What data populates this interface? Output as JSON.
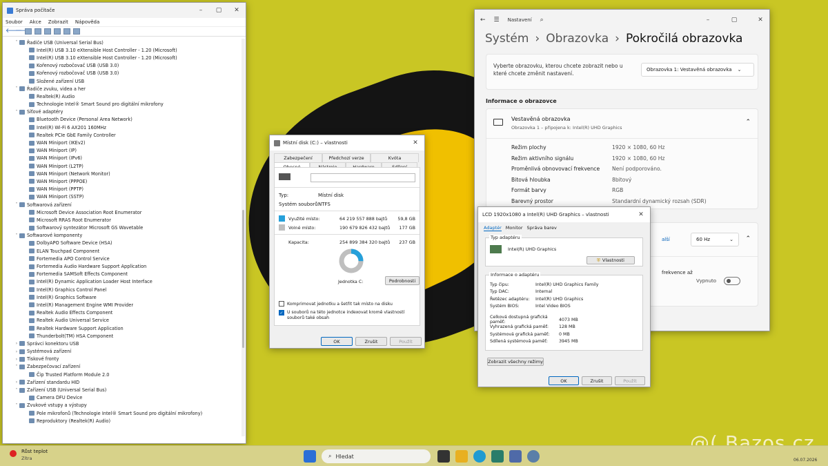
{
  "devmgr": {
    "title": "Správa počítače",
    "menu": [
      "Soubor",
      "Akce",
      "Zobrazit",
      "Nápověda"
    ],
    "tree": [
      {
        "l": 1,
        "a": "˅",
        "t": "Řadiče USB (Universal Serial Bus)"
      },
      {
        "l": 2,
        "a": "",
        "t": "Intel(R) USB 3.10 eXtensible Host Controller - 1.20 (Microsoft)"
      },
      {
        "l": 2,
        "a": "",
        "t": "Intel(R) USB 3.10 eXtensible Host Controller - 1.20 (Microsoft)"
      },
      {
        "l": 2,
        "a": "",
        "t": "Kořenový rozbočovač USB (USB 3.0)"
      },
      {
        "l": 2,
        "a": "",
        "t": "Kořenový rozbočovač USB (USB 3.0)"
      },
      {
        "l": 2,
        "a": "",
        "t": "Složené zařízení USB"
      },
      {
        "l": 1,
        "a": "˅",
        "t": "Řadiče zvuku, videa a her"
      },
      {
        "l": 2,
        "a": "",
        "t": "Realtek(R) Audio"
      },
      {
        "l": 2,
        "a": "",
        "t": "Technologie Intel® Smart Sound pro digitální mikrofony"
      },
      {
        "l": 1,
        "a": "˅",
        "t": "Síťové adaptéry"
      },
      {
        "l": 2,
        "a": "",
        "t": "Bluetooth Device (Personal Area Network)"
      },
      {
        "l": 2,
        "a": "",
        "t": "Intel(R) Wi-Fi 6 AX201 160MHz"
      },
      {
        "l": 2,
        "a": "",
        "t": "Realtek PCIe GbE Family Controller"
      },
      {
        "l": 2,
        "a": "",
        "t": "WAN Miniport (IKEv2)"
      },
      {
        "l": 2,
        "a": "",
        "t": "WAN Miniport (IP)"
      },
      {
        "l": 2,
        "a": "",
        "t": "WAN Miniport (IPv6)"
      },
      {
        "l": 2,
        "a": "",
        "t": "WAN Miniport (L2TP)"
      },
      {
        "l": 2,
        "a": "",
        "t": "WAN Miniport (Network Monitor)"
      },
      {
        "l": 2,
        "a": "",
        "t": "WAN Miniport (PPPOE)"
      },
      {
        "l": 2,
        "a": "",
        "t": "WAN Miniport (PPTP)"
      },
      {
        "l": 2,
        "a": "",
        "t": "WAN Miniport (SSTP)"
      },
      {
        "l": 1,
        "a": "˅",
        "t": "Softwarová zařízení"
      },
      {
        "l": 2,
        "a": "",
        "t": "Microsoft Device Association Root Enumerator"
      },
      {
        "l": 2,
        "a": "",
        "t": "Microsoft RRAS Root Enumerator"
      },
      {
        "l": 2,
        "a": "",
        "t": "Softwarový syntezátor Microsoft GS Wavetable"
      },
      {
        "l": 1,
        "a": "˅",
        "t": "Softwarové komponenty"
      },
      {
        "l": 2,
        "a": "",
        "t": "DolbyAPO Software Device (HSA)"
      },
      {
        "l": 2,
        "a": "",
        "t": "ELAN Touchpad Component"
      },
      {
        "l": 2,
        "a": "",
        "t": "Fortemedia APO Control Service"
      },
      {
        "l": 2,
        "a": "",
        "t": "Fortemedia Audio Hardware Support Application"
      },
      {
        "l": 2,
        "a": "",
        "t": "Fortemedia SAMSoft Effects Component"
      },
      {
        "l": 2,
        "a": "",
        "t": "Intel(R) Dynamic Application Loader Host Interface"
      },
      {
        "l": 2,
        "a": "",
        "t": "Intel(R) Graphics Control Panel"
      },
      {
        "l": 2,
        "a": "",
        "t": "Intel(R) Graphics Software"
      },
      {
        "l": 2,
        "a": "",
        "t": "Intel(R) Management Engine WMI Provider"
      },
      {
        "l": 2,
        "a": "",
        "t": "Realtek Audio Effects Component"
      },
      {
        "l": 2,
        "a": "",
        "t": "Realtek Audio Universal Service"
      },
      {
        "l": 2,
        "a": "",
        "t": "Realtek Hardware Support Application"
      },
      {
        "l": 2,
        "a": "",
        "t": "Thunderbolt(TM) HSA Component"
      },
      {
        "l": 1,
        "a": "›",
        "t": "Správci konektoru USB"
      },
      {
        "l": 1,
        "a": "›",
        "t": "Systémová zařízení"
      },
      {
        "l": 1,
        "a": "›",
        "t": "Tiskové fronty"
      },
      {
        "l": 1,
        "a": "˅",
        "t": "Zabezpečovací zařízení"
      },
      {
        "l": 2,
        "a": "",
        "t": "Čip Trusted Platform Module 2.0"
      },
      {
        "l": 1,
        "a": "›",
        "t": "Zařízení standardu HID"
      },
      {
        "l": 1,
        "a": "˅",
        "t": "Zařízení USB (Universal Serial Bus)"
      },
      {
        "l": 2,
        "a": "",
        "t": "Camera DFU Device"
      },
      {
        "l": 1,
        "a": "˅",
        "t": "Zvukové vstupy a výstupy"
      },
      {
        "l": 2,
        "a": "",
        "t": "Pole mikrofonů (Technologie Intel® Smart Sound pro digitální mikrofony)"
      },
      {
        "l": 2,
        "a": "",
        "t": "Reproduktory (Realtek(R) Audio)"
      }
    ]
  },
  "settings": {
    "app": "Nastavení",
    "crumb1": "Systém",
    "crumb2": "Obrazovka",
    "crumb3": "Pokročilá obrazovka",
    "select_prompt": "Vyberte obrazovku, kterou chcete zobrazit nebo u které chcete změnit nastavení.",
    "display_select": "Obrazovka 1: Vestavěná obrazovka",
    "info_header": "Informace o obrazovce",
    "display_name": "Vestavěná obrazovka",
    "display_sub": "Obrazovka 1 – připojena k: Intel(R) UHD Graphics",
    "info": [
      [
        "Režim plochy",
        "1920 × 1080, 60 Hz"
      ],
      [
        "Režim aktivního signálu",
        "1920 × 1080, 60 Hz"
      ],
      [
        "Proměnlivá obnovovací frekvence",
        "Není podporováno."
      ],
      [
        "Bitová hloubka",
        "8bitový"
      ],
      [
        "Formát barvy",
        "RGB"
      ],
      [
        "Barevný prostor",
        "Standardní dynamický rozsah (SDR)"
      ]
    ],
    "refresh_link": "alší",
    "refresh_value": "60 Hz",
    "freq_text": "frekvence až",
    "toggle_label": "Vypnuto"
  },
  "disk": {
    "title": "Místní disk (C:) – vlastnosti",
    "tabs_top": [
      "Zabezpečení",
      "Předchozí verze",
      "Kvóta"
    ],
    "tabs_bottom": [
      "Obecné",
      "Nástroje",
      "Hardware",
      "Sdílení"
    ],
    "type_k": "Typ:",
    "type_v": "Místní disk",
    "fs_k": "Systém souborů:",
    "fs_v": "NTFS",
    "used_k": "Využité místo:",
    "used_b": "64 219 557 888 bajtů",
    "used_g": "59,8 GB",
    "free_k": "Volné místo:",
    "free_b": "190 679 826 432 bajtů",
    "free_g": "177 GB",
    "cap_k": "Kapacita:",
    "cap_b": "254 899 384 320 bajtů",
    "cap_g": "237 GB",
    "drive": "Jednotka C:",
    "cleanup": "Podrobnosti",
    "cb1": "Komprimovat jednotku a šetřit tak místo na disku",
    "cb2": "U souborů na této jednotce indexovat kromě vlastností souborů také obsah",
    "ok": "OK",
    "cancel": "Zrušit",
    "apply": "Použít",
    "used_fraction": 0.252,
    "used_color": "#26a0da",
    "free_color": "#bfbfbf"
  },
  "gpu": {
    "title": "LCD 1920x1080 a Intel(R) UHD Graphics – vlastnosti",
    "tabs": [
      "Adaptér",
      "Monitor",
      "Správa barev"
    ],
    "type_group": "Typ adaptéru",
    "adapter": "Intel(R) UHD Graphics",
    "props_btn": "Vlastnosti",
    "info_group": "Informace o adaptéru",
    "info": [
      [
        "Typ čipu:",
        "Intel(R) UHD Graphics Family"
      ],
      [
        "Typ DAC:",
        "Internal"
      ],
      [
        "Řetězec adaptéru:",
        "Intel(R) UHD Graphics"
      ],
      [
        "Systém BIOS:",
        "Intel Video BIOS"
      ]
    ],
    "mem": [
      [
        "Celková dostupná grafická paměť:",
        "4073 MB"
      ],
      [
        "Vyhrazená grafická paměť:",
        "128 MB"
      ],
      [
        "Systémová grafická paměť:",
        "0 MB"
      ],
      [
        "Sdílená systémová paměť:",
        "3945 MB"
      ]
    ],
    "modes_btn": "Zobrazit všechny režimy",
    "ok": "OK",
    "cancel": "Zrušit",
    "apply": "Použít"
  },
  "taskbar": {
    "weather1": "Růst teplot",
    "weather2": "Zítra",
    "search": "Hledat",
    "date": "06.07.2026"
  },
  "watermark": "@( Bazos.cz"
}
